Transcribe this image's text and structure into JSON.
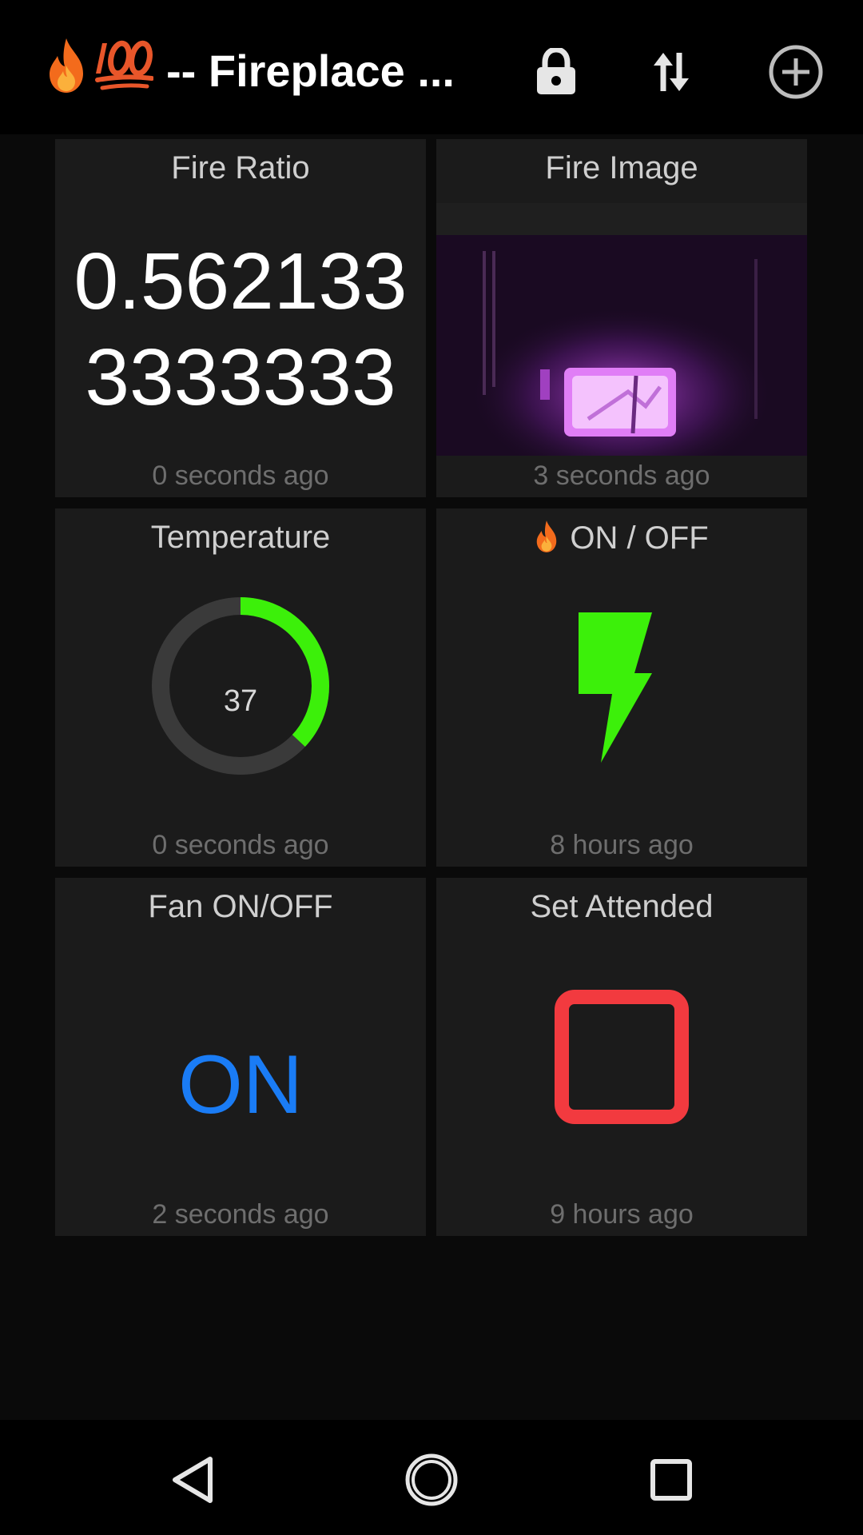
{
  "appbar": {
    "title": "-- Fireplace ...",
    "actions": {
      "lock_icon": "lock-icon",
      "sync_icon": "swap-vertical-icon",
      "add_icon": "add-circle-icon"
    }
  },
  "tiles": {
    "fire_ratio": {
      "title": "Fire Ratio",
      "value": "0.5621333333333",
      "updated": "0 seconds ago"
    },
    "fire_image": {
      "title": "Fire Image",
      "updated": "3 seconds ago"
    },
    "temperature": {
      "title": "Temperature",
      "value": "37",
      "gauge_fraction": 0.37,
      "gauge_color": "#3cf00a",
      "track_color": "#3a3a3a",
      "updated": "0 seconds ago"
    },
    "power": {
      "title": "ON / OFF",
      "icon": "lightning-bolt-icon",
      "icon_color": "#3cf00a",
      "updated": "8 hours ago"
    },
    "fan": {
      "title": "Fan ON/OFF",
      "state": "ON",
      "state_color": "#1a7cf5",
      "updated": "2 seconds ago"
    },
    "attended": {
      "title": "Set Attended",
      "checked": false,
      "box_color": "#f23a3f",
      "updated": "9 hours ago"
    }
  },
  "navbar": {
    "back_icon": "back-triangle-icon",
    "home_icon": "home-circle-icon",
    "recents_icon": "recents-square-icon"
  }
}
